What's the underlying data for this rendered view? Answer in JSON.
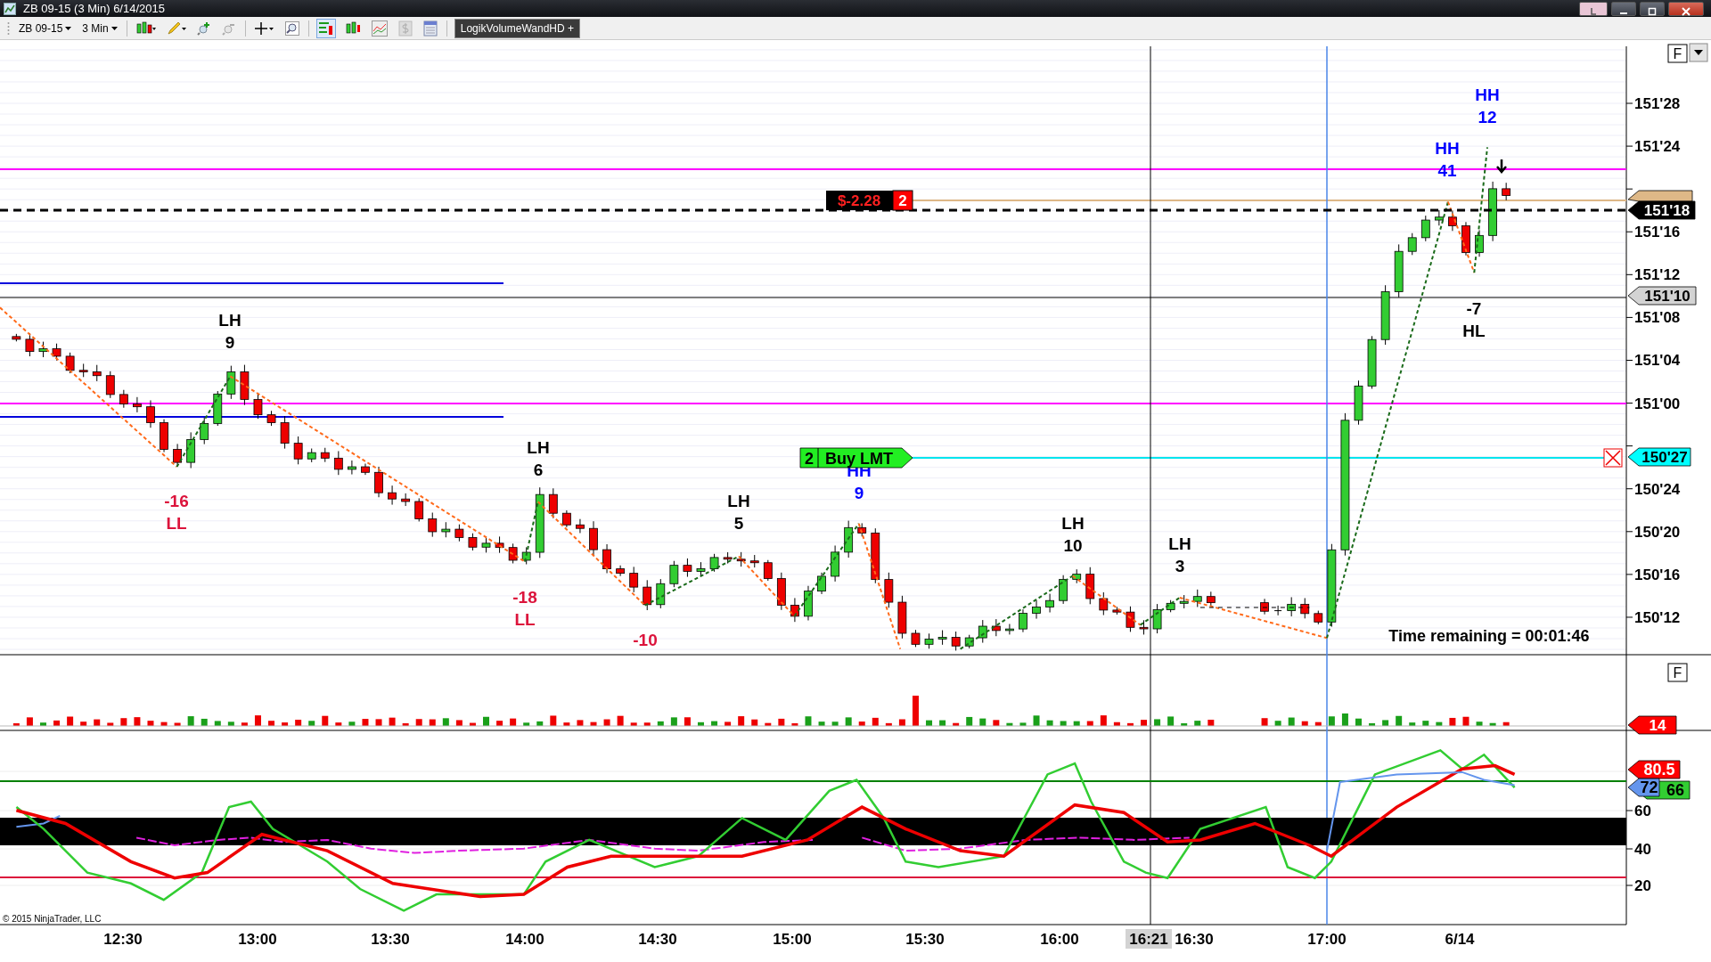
{
  "window": {
    "title": "ZB 09-15 (3 Min)  6/14/2015"
  },
  "toolbar": {
    "instrument": "ZB 09-15",
    "interval": "3 Min",
    "indicator_button": "LogikVolumeWandHD +"
  },
  "panel_buttons": [
    "F",
    "F"
  ],
  "price_axis": [
    "151'28",
    "151'24",
    "151'16",
    "151'12",
    "151'08",
    "151'04",
    "151'00",
    "150'24",
    "150'20",
    "150'16",
    "150'12"
  ],
  "entry_tag": {
    "color": "#deb887"
  },
  "price_tags": [
    {
      "text": "151'18",
      "color": "#000000"
    },
    {
      "text": "151'10",
      "color": "#d3d3d3"
    },
    {
      "text": "150'27",
      "color": "#00ffff"
    }
  ],
  "position_tag": {
    "pnl": "$-2.28",
    "quantity": "2"
  },
  "order_tag": {
    "quantity": "2",
    "label": "Buy LMT"
  },
  "swing_labels": [
    {
      "lines": [
        "LH",
        "9"
      ],
      "color": "#000000"
    },
    {
      "lines": [
        "-16",
        "LL"
      ],
      "color": "#dc143c"
    },
    {
      "lines": [
        "LH",
        "6"
      ],
      "color": "#000000"
    },
    {
      "lines": [
        "-18",
        "LL"
      ],
      "color": "#dc143c"
    },
    {
      "lines": [
        "-10"
      ],
      "color": "#dc143c"
    },
    {
      "lines": [
        "LH",
        "5"
      ],
      "color": "#000000"
    },
    {
      "lines": [
        "HH",
        "9"
      ],
      "color": "#0000ff"
    },
    {
      "lines": [
        "LH",
        "10"
      ],
      "color": "#000000"
    },
    {
      "lines": [
        "LH",
        "3"
      ],
      "color": "#000000"
    },
    {
      "lines": [
        "HH",
        "41"
      ],
      "color": "#0000ff"
    },
    {
      "lines": [
        "HH",
        "12"
      ],
      "color": "#0000ff"
    },
    {
      "lines": [
        "-7",
        "HL"
      ],
      "color": "#000000"
    }
  ],
  "time_remaining": "Time remaining = 00:01:46",
  "volume_tag": {
    "text": "14",
    "color": "#ff0000"
  },
  "indicator_tags": [
    {
      "text": "80.5",
      "color": "#ff0000"
    },
    {
      "text": "66",
      "color": "#32cd32"
    },
    {
      "text": "72",
      "color": "#6495ed"
    }
  ],
  "indicator_axis": [
    "60",
    "40",
    "20"
  ],
  "copyright": "© 2015 NinjaTrader, LLC",
  "time_axis": [
    {
      "text": "12:30",
      "highlighted": false
    },
    {
      "text": "13:00",
      "highlighted": false
    },
    {
      "text": "13:30",
      "highlighted": false
    },
    {
      "text": "14:00",
      "highlighted": false
    },
    {
      "text": "14:30",
      "highlighted": false
    },
    {
      "text": "15:00",
      "highlighted": false
    },
    {
      "text": "15:30",
      "highlighted": false
    },
    {
      "text": "16:00",
      "highlighted": false
    },
    {
      "text": "16:21",
      "highlighted": true
    },
    {
      "text": "16:30",
      "highlighted": false
    },
    {
      "text": "17:00",
      "highlighted": false
    },
    {
      "text": "6/14",
      "highlighted": false
    }
  ]
}
